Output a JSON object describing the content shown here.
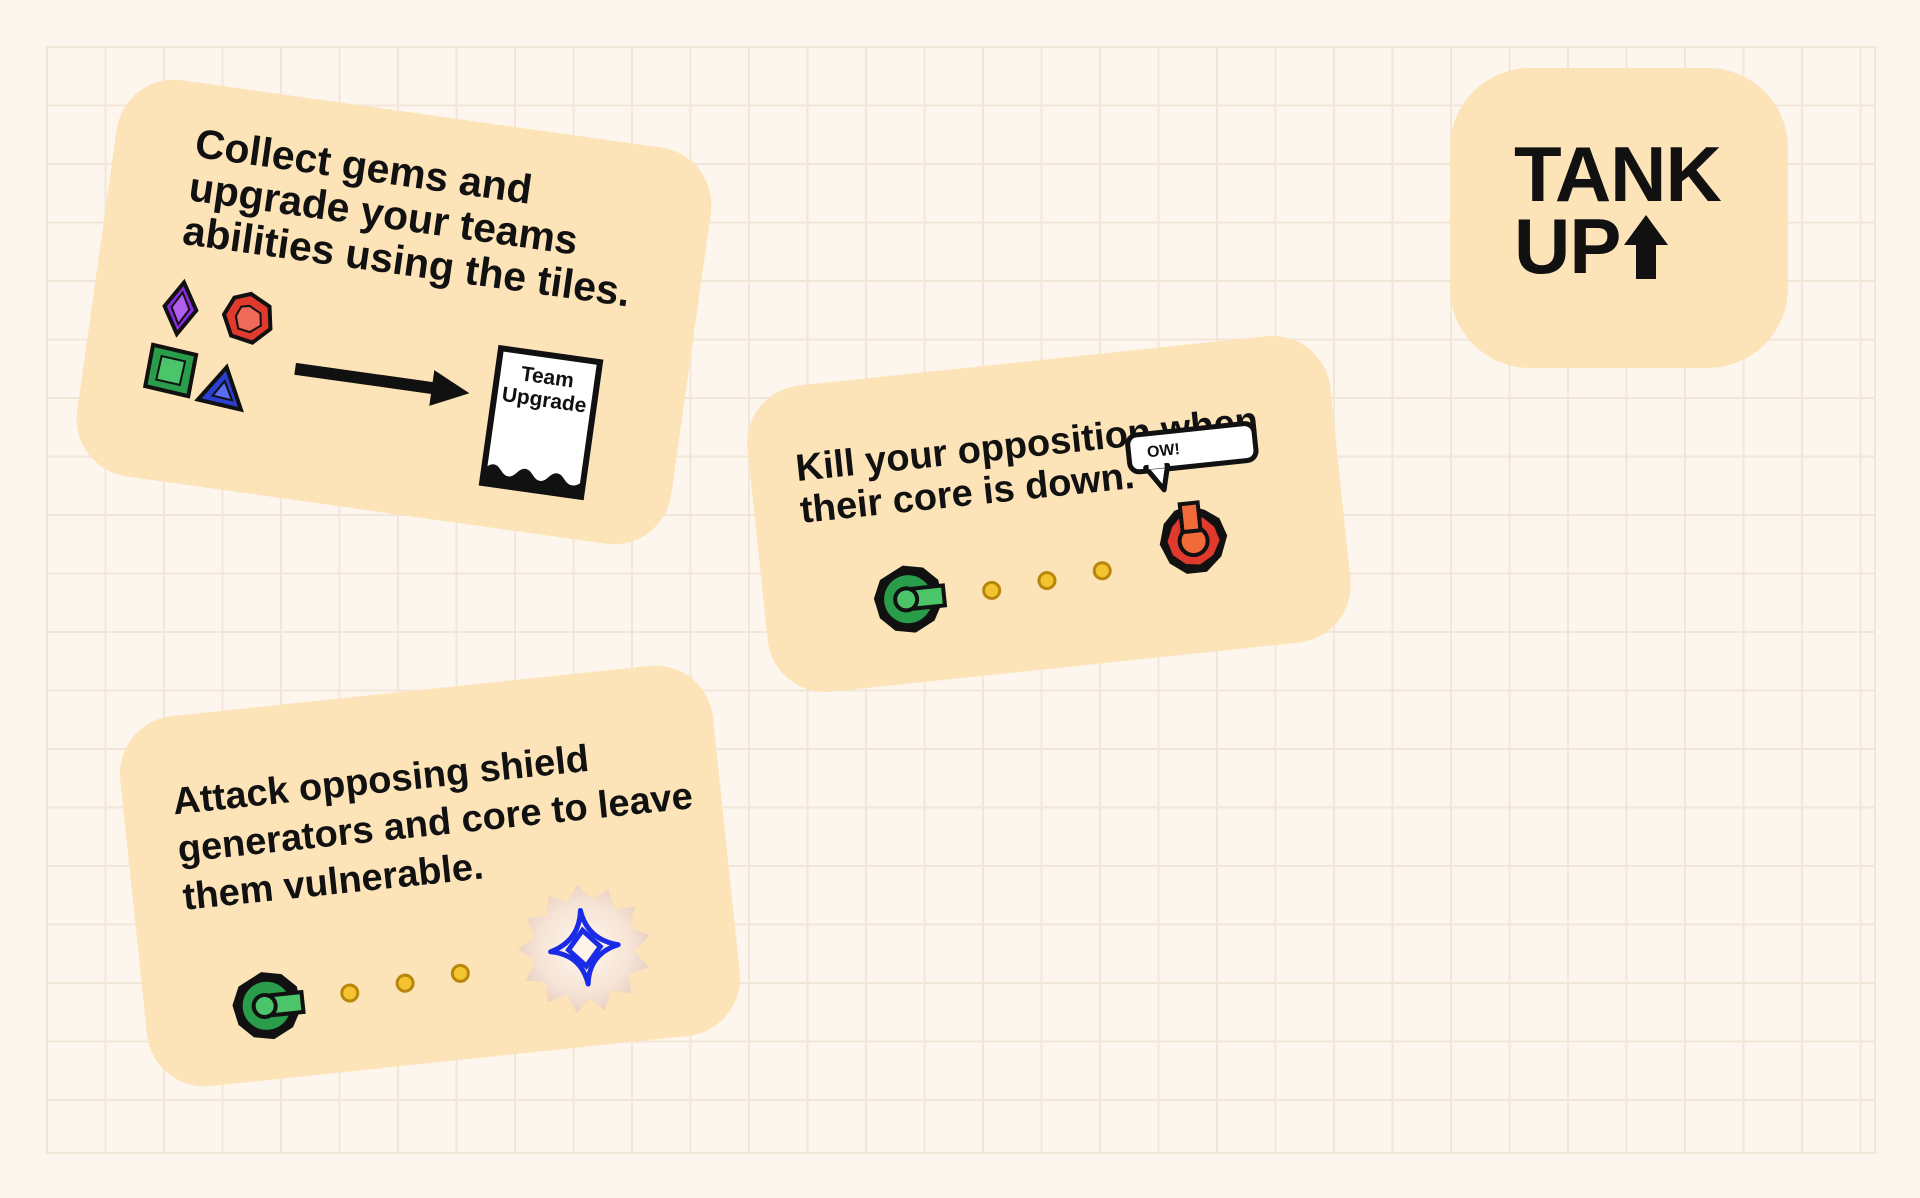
{
  "logo": {
    "line1": "TANK",
    "line2": "UP",
    "arrow_icon": "up-arrow-icon"
  },
  "cards": {
    "gems": {
      "text": "Collect gems and upgrade your teams abilities using the tiles.",
      "tile_line1": "Team",
      "tile_line2": "Upgrade",
      "gems": [
        "purple-diamond-gem",
        "red-hexagon-gem",
        "green-square-gem",
        "blue-triangle-gem"
      ]
    },
    "kill": {
      "text": "Kill your opposition when their core is down.",
      "speech": "OW!"
    },
    "attack": {
      "text": "Attack opposing shield generators and core to leave them vulnerable."
    }
  },
  "colors": {
    "background": "#fdf6ee",
    "card": "#fde3b8",
    "green_tank": "#2a9d4a",
    "red_tank": "#e03a2f",
    "bullet": "#f4c430",
    "shield_icon": "#1a2be8"
  }
}
